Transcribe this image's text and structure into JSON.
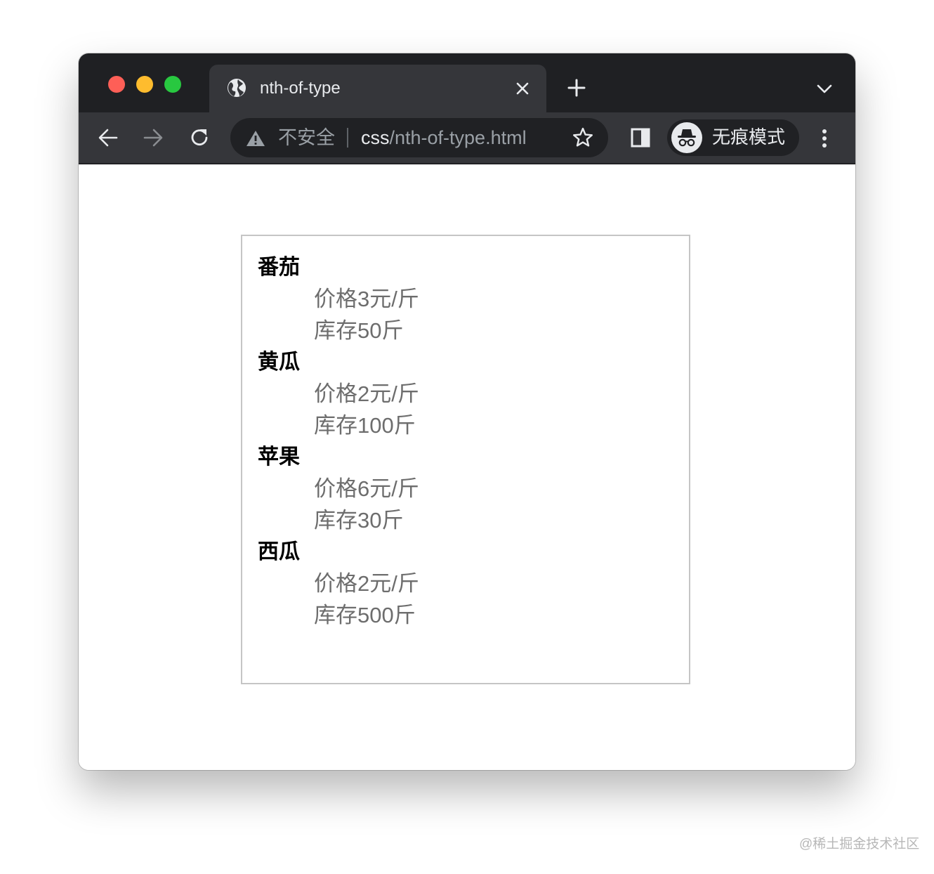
{
  "browser": {
    "tab": {
      "title": "nth-of-type"
    },
    "omnibox": {
      "security_text": "不安全",
      "url_host": "css",
      "url_path": "/nth-of-type.html"
    },
    "profile": {
      "label": "无痕模式"
    },
    "icons": {
      "favicon": "globe-icon",
      "tab_close": "close-icon",
      "new_tab": "plus-icon",
      "tab_search": "chevron-down-icon",
      "back": "arrow-left-icon",
      "forward": "arrow-right-icon",
      "reload": "reload-icon",
      "security": "warning-icon",
      "bookmark": "star-icon",
      "side_panel": "side-panel-icon",
      "incognito": "incognito-icon",
      "menu": "kebab-menu-icon"
    },
    "colors": {
      "frame": "#1f2023",
      "toolbar": "#35363a",
      "omnibox": "#202124",
      "close_dot": "#fe5f57",
      "minimize_dot": "#febc2e",
      "zoom_dot": "#28c840"
    }
  },
  "page": {
    "items": [
      {
        "name": "番茄",
        "price": "价格3元/斤",
        "stock": "库存50斤"
      },
      {
        "name": "黄瓜",
        "price": "价格2元/斤",
        "stock": "库存100斤"
      },
      {
        "name": "苹果",
        "price": "价格6元/斤",
        "stock": "库存30斤"
      },
      {
        "name": "西瓜",
        "price": "价格2元/斤",
        "stock": "库存500斤"
      }
    ],
    "colors": {
      "term": "#000000",
      "description": "#6d6d6d",
      "border": "#c5c5c5"
    }
  },
  "watermark": "@稀土掘金技术社区"
}
